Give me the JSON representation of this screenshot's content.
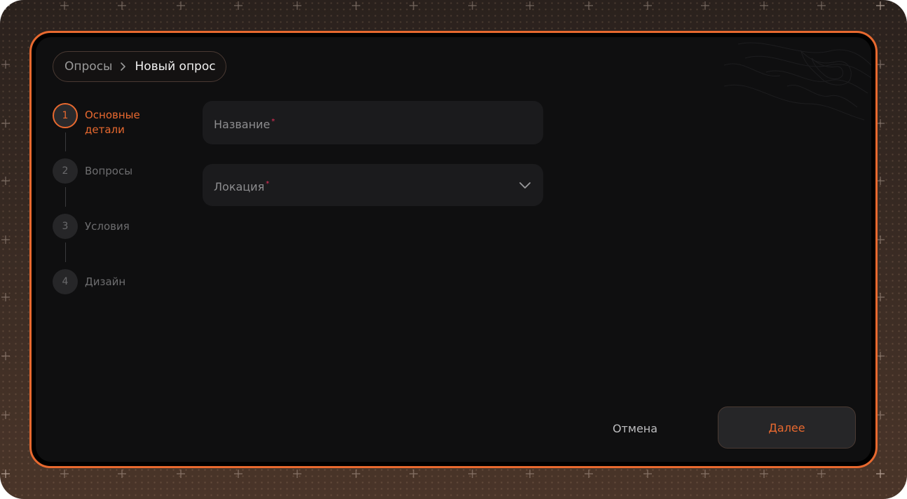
{
  "breadcrumb": {
    "parent": "Опросы",
    "current": "Новый опрос"
  },
  "steps": [
    {
      "number": "1",
      "label": "Основные детали",
      "active": true
    },
    {
      "number": "2",
      "label": "Вопросы",
      "active": false
    },
    {
      "number": "3",
      "label": "Условия",
      "active": false
    },
    {
      "number": "4",
      "label": "Дизайн",
      "active": false
    }
  ],
  "form": {
    "name_label": "Название",
    "location_label": "Локация",
    "required_mark": "*"
  },
  "actions": {
    "cancel": "Отмена",
    "next": "Далее"
  },
  "colors": {
    "accent": "#e8692f",
    "required": "#e8305a",
    "card_background": "#0f0f10",
    "field_background": "#1b1b1d"
  },
  "icons": {
    "breadcrumb_separator": "chevron-right-icon",
    "location_select": "chevron-down-icon"
  }
}
